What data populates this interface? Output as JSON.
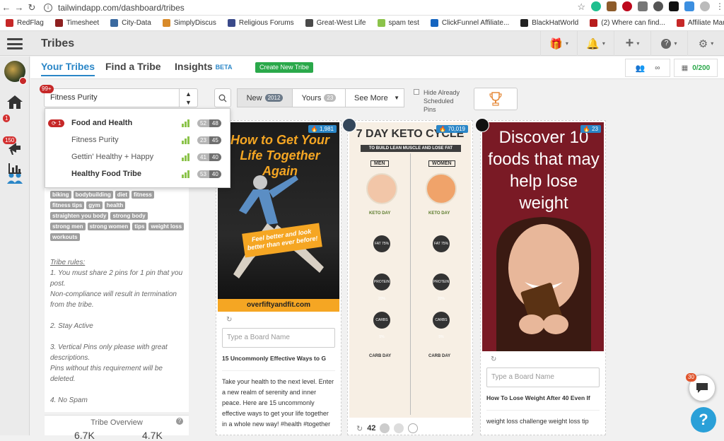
{
  "browser": {
    "url": "tailwindapp.com/dashboard/tribes"
  },
  "bookmarks": [
    {
      "label": "RedFlag",
      "color": "#c62828"
    },
    {
      "label": "Timesheet",
      "color": "#8e2020"
    },
    {
      "label": "City-Data",
      "color": "#3b6aa0"
    },
    {
      "label": "SimplyDiscus",
      "color": "#d88a2a"
    },
    {
      "label": "Religious Forums",
      "color": "#3a4a8a"
    },
    {
      "label": "Great-West Life",
      "color": "#4a4a4a"
    },
    {
      "label": "spam test",
      "color": "#8bc34a"
    },
    {
      "label": "ClickFunnel Affiliate...",
      "color": "#1565c0"
    },
    {
      "label": "BlackHatWorld",
      "color": "#222222"
    },
    {
      "label": "(2) Where can find...",
      "color": "#b71c1c"
    },
    {
      "label": "Affiliate Marketing...",
      "color": "#c62828"
    }
  ],
  "header": {
    "title": "Tribes"
  },
  "sidebar": {
    "badges": [
      "1",
      "150"
    ]
  },
  "tabs": [
    {
      "label": "Your Tribes",
      "active": true
    },
    {
      "label": "Find a Tribe",
      "active": false
    },
    {
      "label": "Insights",
      "active": false
    }
  ],
  "tabs_beta": "BETA",
  "new_tribe_label": "Create New Tribe",
  "stats": {
    "infinity": "∞",
    "usage": "0/200"
  },
  "tribe_select": {
    "value": "Fitness Purity",
    "badge": "99+"
  },
  "filters": {
    "new_label": "New",
    "new_count": "2012",
    "yours_label": "Yours",
    "yours_count": "23",
    "more_label": "See More",
    "hide_scheduled": "Hide Already Scheduled Pins"
  },
  "dropdown": [
    {
      "name": "Food and Health",
      "badge": "1",
      "a": "52",
      "b": "48",
      "bold": true
    },
    {
      "name": "Fitness Purity",
      "a": "23",
      "b": "45",
      "bold": false
    },
    {
      "name": "Gettin' Healthy + Happy",
      "a": "41",
      "b": "40",
      "bold": false
    },
    {
      "name": "Healthy Food Tribe",
      "a": "53",
      "b": "40",
      "bold": true
    }
  ],
  "tags": [
    "biking",
    "bodybuilding",
    "diet",
    "fitness",
    "fitness tips",
    "gym",
    "health",
    "straighten you body",
    "strong body",
    "strong men",
    "strong women",
    "tips",
    "weight loss",
    "workouts"
  ],
  "rules": {
    "heading": "Tribe rules:",
    "r1": "1. You must share 2 pins for 1 pin that you post.",
    "r1b": "Non-compliance will result in termination from the tribe.",
    "r2": "2. Stay Active",
    "r3": "3. Vertical Pins only please with great descriptions.",
    "r3b": "Pins without this requirement will be deleted.",
    "r4": "4. No Spam"
  },
  "overview": {
    "title": "Tribe Overview",
    "left": "6.7K",
    "right": "4.7K"
  },
  "cards": [
    {
      "repins": "1,981",
      "img_title": "How to Get Your Life Together Again",
      "img_banner": "Feel better and look better than ever before!",
      "img_footer": "overfiftyandfit.com",
      "board_placeholder": "Type a Board Name",
      "title": "15 Uncommonly Effective Ways to G",
      "desc": "Take your health to the next level. Enter a new realm of serenity and inner peace. Here are 15 uncommonly effective ways to get your life together in a whole new way! #health #together"
    },
    {
      "repins": "70,019",
      "img_title": "7 DAY KETO CYCLE",
      "img_sub": "TO BUILD LEAN MUSCLE AND LOSE FAT",
      "col_left": "MEN",
      "col_right": "WOMEN",
      "keto_day": "KETO DAY",
      "carb_day": "CARB DAY",
      "circles": [
        "FAT 75%",
        "PROTEIN 20%",
        "CARBS 5%"
      ],
      "footer_count": "42"
    },
    {
      "repins": "23",
      "img_title": "Discover 10 foods that may help lose weight",
      "board_placeholder": "Type a Board Name",
      "title": "How To Lose Weight After 40 Even If",
      "desc": "weight loss challenge weight loss tip"
    }
  ],
  "chat_count": "30"
}
